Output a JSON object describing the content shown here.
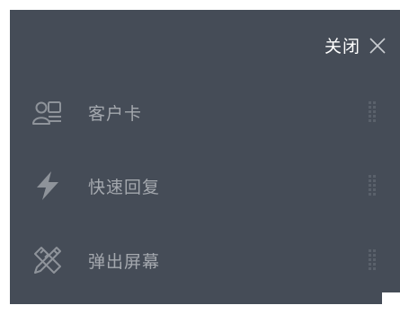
{
  "header": {
    "close_label": "关闭"
  },
  "menu": {
    "items": [
      {
        "label": "客户卡",
        "icon": "customer-card-icon"
      },
      {
        "label": "快速回复",
        "icon": "lightning-icon"
      },
      {
        "label": "弹出屏幕",
        "icon": "pencil-ruler-icon"
      }
    ]
  },
  "colors": {
    "panel_bg": "#454c57",
    "label": "#a4a8ae",
    "close_label": "#ffffff"
  }
}
